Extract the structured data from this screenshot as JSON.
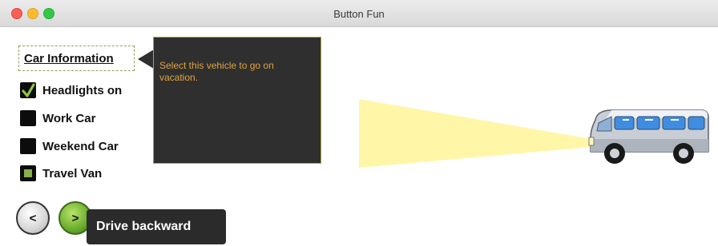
{
  "window": {
    "title": "Button Fun"
  },
  "link": {
    "label": "Car Information"
  },
  "tooltip": {
    "text": "Select this vehicle to go on vacation."
  },
  "checkboxes": [
    {
      "label": "Headlights on",
      "state": "checked"
    },
    {
      "label": "Work Car",
      "state": "unchecked"
    },
    {
      "label": "Weekend Car",
      "state": "unchecked"
    },
    {
      "label": "Travel Van",
      "state": "indeterminate"
    }
  ],
  "nav": {
    "back_label": "<",
    "forward_label": ">"
  },
  "hint": {
    "text": "Drive backward"
  },
  "colors": {
    "tooltip_bg": "#2f2f2f",
    "tooltip_text": "#e0a53c",
    "beam": "#fff6a8",
    "forward_button": "#6aac2c"
  }
}
